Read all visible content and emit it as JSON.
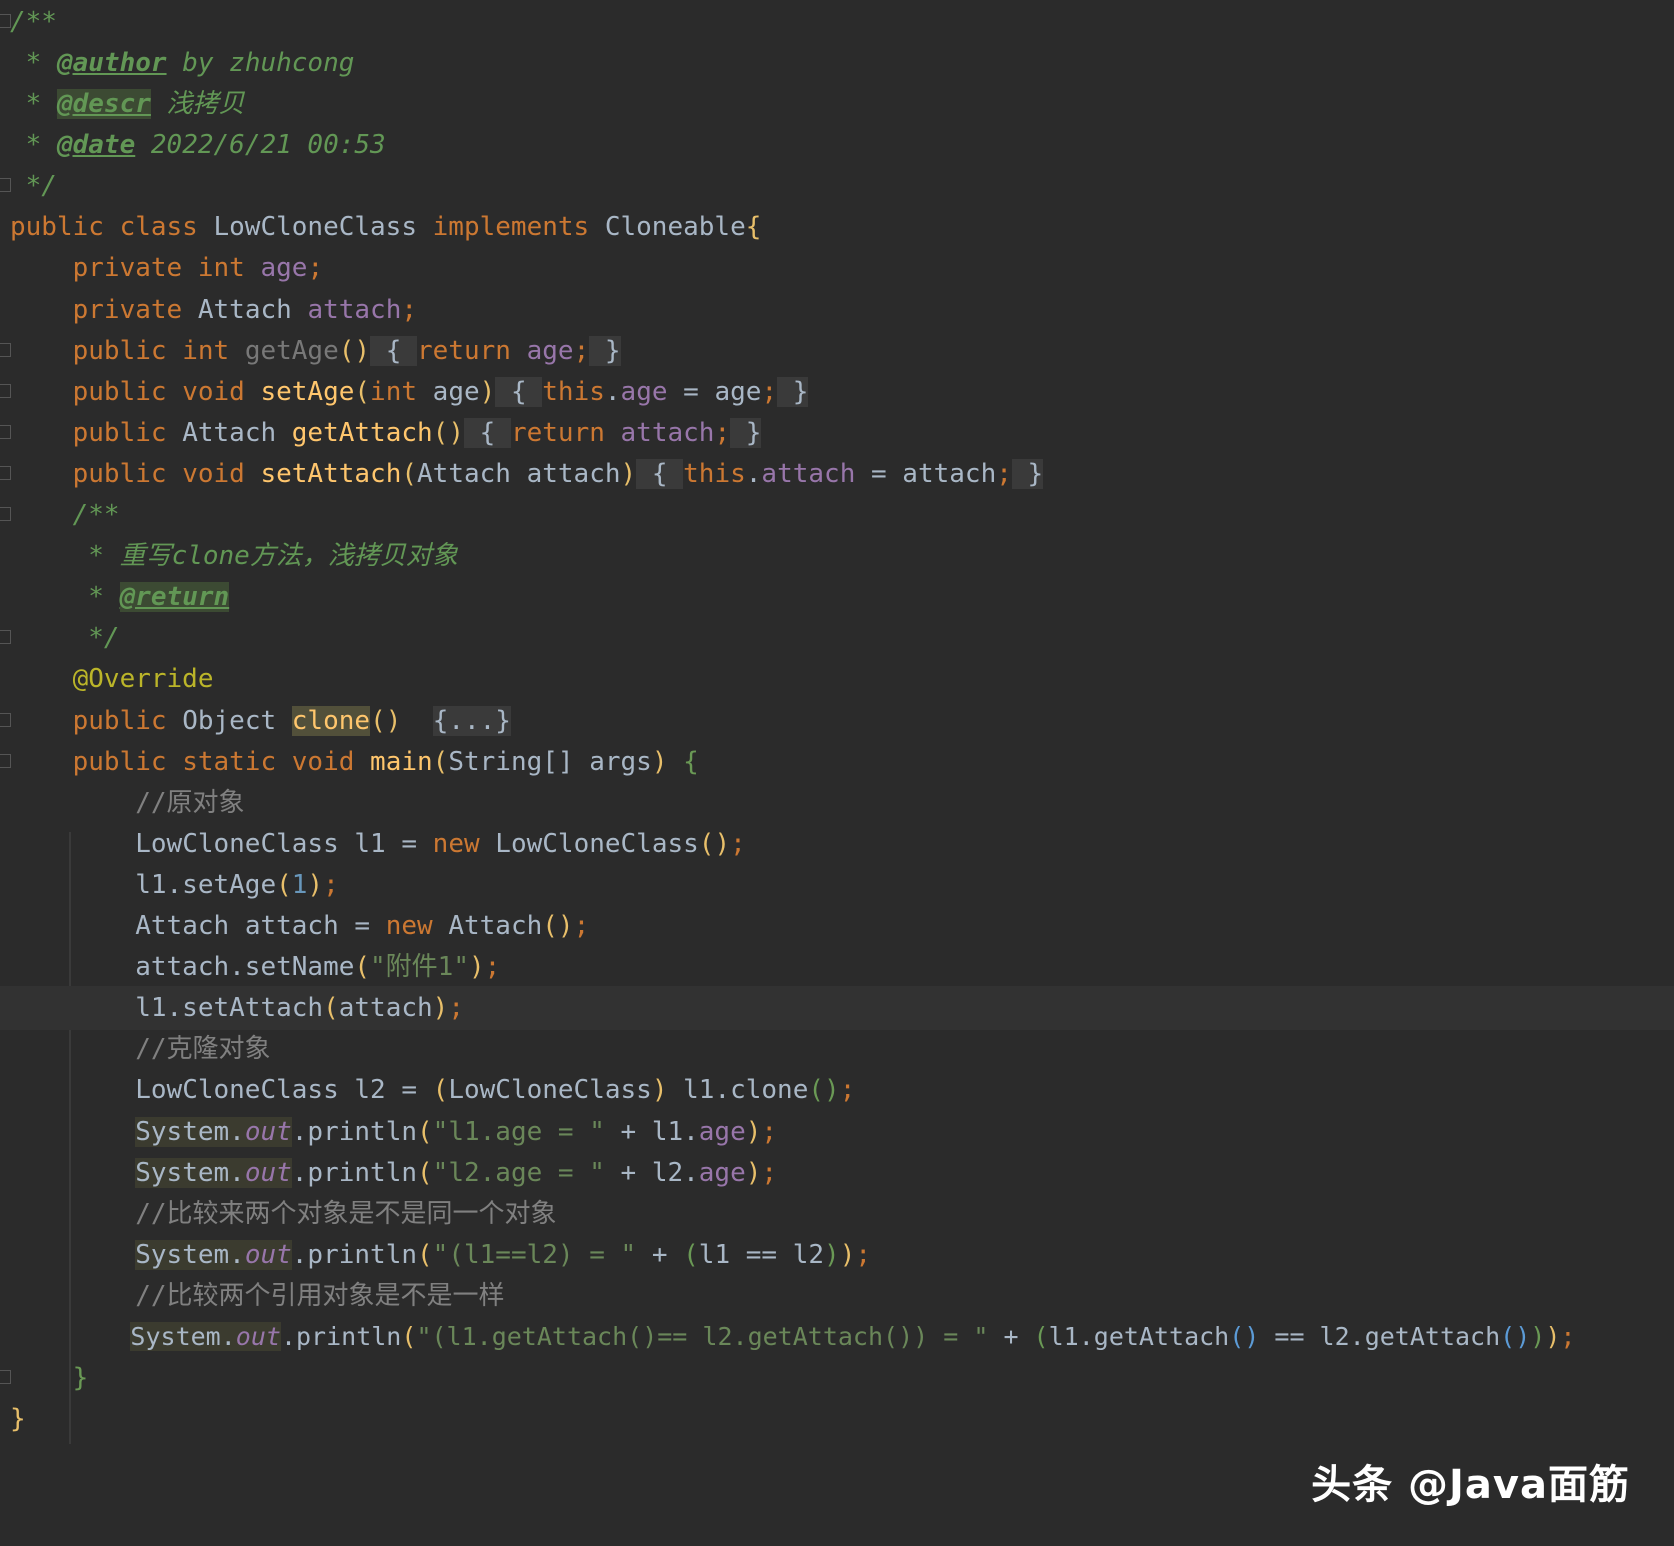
{
  "editor": {
    "lines": [
      "/**",
      " * @author by zhuhcong",
      " * @descr 浅拷贝",
      " * @date 2022/6/21 00:53",
      " */",
      "public class LowCloneClass implements Cloneable{",
      "    private int age;",
      "    private Attach attach;",
      "    public int getAge() { return age; }",
      "    public void setAge(int age) { this.age = age; }",
      "    public Attach getAttach() { return attach; }",
      "    public void setAttach(Attach attach) { this.attach = attach; }",
      "    /**",
      "     * 重写clone方法，浅拷贝对象",
      "     * @return",
      "     */",
      "    @Override",
      "    public Object clone()  {...}",
      "    public static void main(String[] args) {",
      "        //原对象",
      "        LowCloneClass l1 = new LowCloneClass();",
      "        l1.setAge(1);",
      "        Attach attach = new Attach();",
      "        attach.setName(\"附件1\");",
      "        l1.setAttach(attach);",
      "        //克隆对象",
      "        LowCloneClass l2 = (LowCloneClass) l1.clone();",
      "        System.out.println(\"l1.age = \" + l1.age);",
      "        System.out.println(\"l2.age = \" + l2.age);",
      "        //比较来两个对象是不是同一个对象",
      "        System.out.println(\"(l1==l2) = \" + (l1 == l2));",
      "        //比较两个引用对象是不是一样",
      "        System.out.println(\"(l1.getAttach()== l2.getAttach()) = \" + (l1.getAttach() == l2.getAttach()));",
      "    }",
      "}"
    ],
    "current_line_index": 24,
    "theme_colors": {
      "background": "#2b2b2b",
      "keyword": "#cc7832",
      "field": "#9876aa",
      "method": "#ffc66d",
      "number": "#6897bb",
      "string": "#6a8759",
      "comment": "#808080",
      "doc": "#629755",
      "annotation": "#bbb529"
    }
  },
  "watermark": {
    "text": "头条 @Java面筋"
  }
}
